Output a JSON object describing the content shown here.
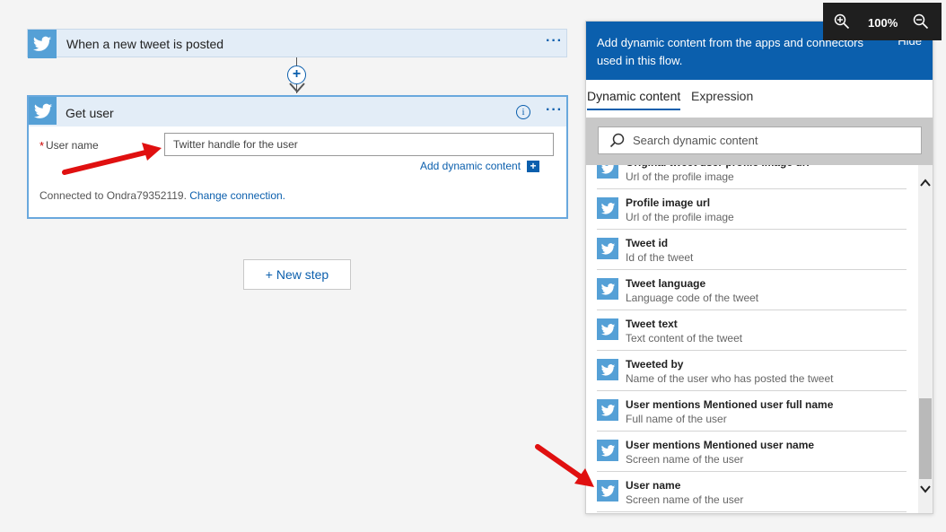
{
  "trigger": {
    "title": "When a new tweet is posted",
    "menu": "···"
  },
  "connector": {
    "plus": "+"
  },
  "action": {
    "title": "Get user",
    "menu": "···",
    "info": "i",
    "required_marker": "*",
    "field_label": "User name",
    "field_placeholder": "Twitter handle for the user",
    "add_dynamic": "Add dynamic content",
    "add_dynamic_plus": "+",
    "connected_text": "Connected to Ondra79352119.",
    "change_connection": "Change connection."
  },
  "new_step": "+ New step",
  "panel": {
    "header_text": "Add dynamic content from the apps and connectors used in this flow.",
    "hide": "Hide",
    "tabs": [
      "Dynamic content",
      "Expression"
    ],
    "search_placeholder": "Search dynamic content",
    "items": [
      {
        "name": "Original tweet user profile image url",
        "desc": "Url of the profile image"
      },
      {
        "name": "Profile image url",
        "desc": "Url of the profile image"
      },
      {
        "name": "Tweet id",
        "desc": "Id of the tweet"
      },
      {
        "name": "Tweet language",
        "desc": "Language code of the tweet"
      },
      {
        "name": "Tweet text",
        "desc": "Text content of the tweet"
      },
      {
        "name": "Tweeted by",
        "desc": "Name of the user who has posted the tweet"
      },
      {
        "name": "User mentions Mentioned user full name",
        "desc": "Full name of the user"
      },
      {
        "name": "User mentions Mentioned user name",
        "desc": "Screen name of the user"
      },
      {
        "name": "User name",
        "desc": "Screen name of the user"
      }
    ]
  },
  "zoom": {
    "value": "100%"
  },
  "colors": {
    "accent": "#0b5fad",
    "twitter": "#55a0d6",
    "annotation": "#e01010"
  }
}
